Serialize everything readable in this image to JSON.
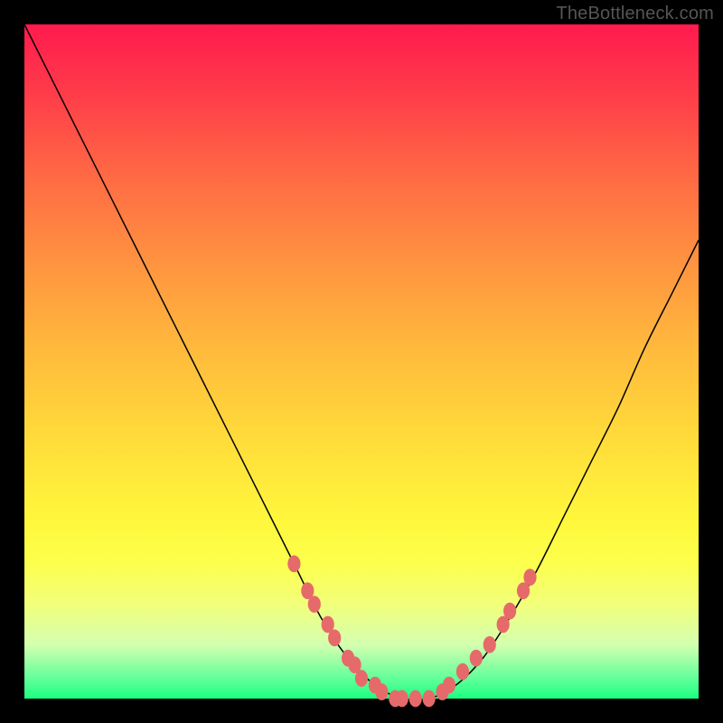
{
  "watermark": "TheBottleneck.com",
  "colors": {
    "curve_stroke": "#000000",
    "dot_fill": "#e66a6a",
    "dot_stroke": "#e66a6a"
  },
  "chart_data": {
    "type": "line",
    "title": "",
    "xlabel": "",
    "ylabel": "",
    "xlim": [
      0,
      100
    ],
    "ylim": [
      0,
      100
    ],
    "series": [
      {
        "name": "bottleneck-curve",
        "x": [
          0,
          5,
          10,
          15,
          20,
          25,
          30,
          35,
          40,
          44,
          48,
          52,
          56,
          60,
          64,
          68,
          72,
          76,
          80,
          84,
          88,
          92,
          96,
          100
        ],
        "y": [
          100,
          90,
          80,
          70,
          60,
          50,
          40,
          30,
          20,
          12,
          6,
          2,
          0,
          0,
          2,
          6,
          12,
          19,
          27,
          35,
          43,
          52,
          60,
          68
        ]
      }
    ],
    "markers": [
      {
        "x": 40,
        "y": 20
      },
      {
        "x": 42,
        "y": 16
      },
      {
        "x": 43,
        "y": 14
      },
      {
        "x": 45,
        "y": 11
      },
      {
        "x": 46,
        "y": 9
      },
      {
        "x": 48,
        "y": 6
      },
      {
        "x": 49,
        "y": 5
      },
      {
        "x": 50,
        "y": 3
      },
      {
        "x": 52,
        "y": 2
      },
      {
        "x": 53,
        "y": 1
      },
      {
        "x": 55,
        "y": 0
      },
      {
        "x": 56,
        "y": 0
      },
      {
        "x": 58,
        "y": 0
      },
      {
        "x": 60,
        "y": 0
      },
      {
        "x": 62,
        "y": 1
      },
      {
        "x": 63,
        "y": 2
      },
      {
        "x": 65,
        "y": 4
      },
      {
        "x": 67,
        "y": 6
      },
      {
        "x": 69,
        "y": 8
      },
      {
        "x": 71,
        "y": 11
      },
      {
        "x": 72,
        "y": 13
      },
      {
        "x": 74,
        "y": 16
      },
      {
        "x": 75,
        "y": 18
      }
    ]
  }
}
